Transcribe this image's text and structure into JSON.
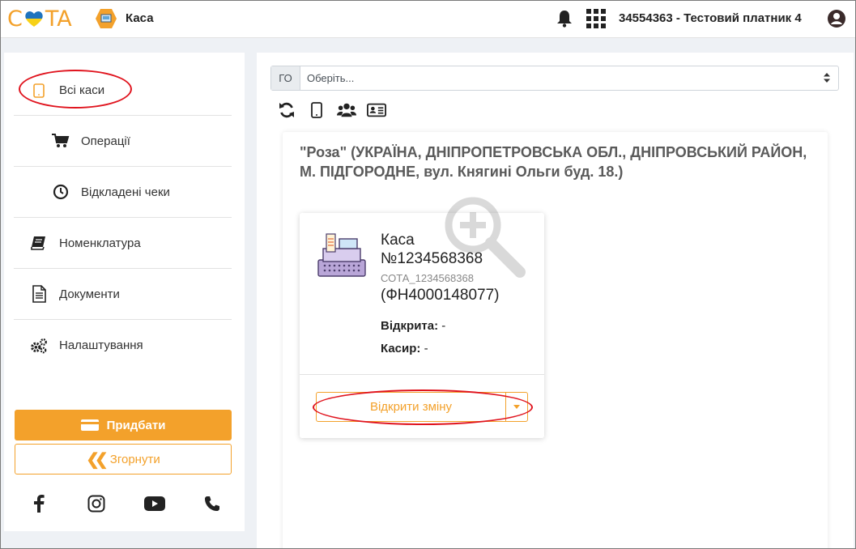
{
  "header": {
    "logo_text_left": "C",
    "logo_text_right": "TA",
    "app_title": "Каса",
    "user_label": "34554363 - Тестовий платник 4",
    "icons": [
      "bell-icon",
      "apps-grid-icon",
      "user-circle-icon"
    ]
  },
  "sidebar": {
    "items": [
      {
        "label": "Всі каси",
        "icon": "tablet-icon"
      },
      {
        "label": "Операції",
        "icon": "cart-icon"
      },
      {
        "label": "Відкладені чеки",
        "icon": "clock-icon"
      },
      {
        "label": "Номенклатура",
        "icon": "book-icon"
      },
      {
        "label": "Документи",
        "icon": "document-icon"
      },
      {
        "label": "Налаштування",
        "icon": "gears-icon"
      }
    ],
    "buy_label": "Придбати",
    "collapse_label": "Згорнути",
    "socials": [
      "facebook-icon",
      "instagram-icon",
      "youtube-icon",
      "phone-icon"
    ]
  },
  "main": {
    "select": {
      "prefix": "ГО",
      "value": "Оберіть..."
    },
    "toolbar": [
      "refresh-icon",
      "tablet-icon",
      "users-icon",
      "id-card-icon"
    ],
    "store": {
      "title": "\"Роза\" (УКРАЇНА, ДНІПРОПЕТРОВСЬКА ОБЛ., ДНІПРОВСЬКИЙ РАЙОН, М. ПІДГОРОДНЕ, вул. Княгині Ольги буд. 18.)",
      "cash": {
        "name_line1": "Каса",
        "name_line2": "№1234568368",
        "code": "СОТА_1234568368",
        "fn": "(ФН4000148077)",
        "opened_label": "Відкрита:",
        "opened_value": " -",
        "cashier_label": "Касир:",
        "cashier_value": " -",
        "open_shift_label": "Відкрити зміну"
      }
    }
  },
  "colors": {
    "accent": "#f3a12b",
    "highlight": "#e0141e",
    "logo_heart_blue": "#1e73be",
    "logo_heart_yellow": "#f7d117"
  }
}
